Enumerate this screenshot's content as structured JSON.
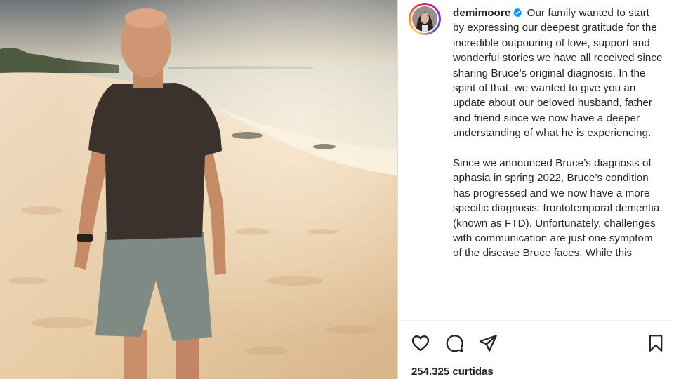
{
  "post": {
    "username": "demimoore",
    "verified_icon": "verified-badge-icon",
    "caption_paragraphs": [
      "Our family wanted to start by expressing our deepest gratitude for the incredible outpouring of love, support and wonderful stories we have all received since sharing Bruce’s original diagnosis. In the spirit of that, we wanted to give you an update about our beloved husband, father and friend since we now have a deeper understanding of what he is experiencing.",
      "Since we announced Bruce’s diagnosis of aphasia in spring 2022, Bruce’s condition has progressed and we now have a more specific diagnosis: frontotemporal dementia (known as FTD). Unfortunately, challenges with communication are just one symptom of the disease Bruce faces. While this"
    ],
    "likes_text": "254.325 curtidas"
  },
  "actions": {
    "like_icon": "heart-icon",
    "comment_icon": "comment-icon",
    "share_icon": "paper-plane-icon",
    "save_icon": "bookmark-icon"
  },
  "colors": {
    "text": "#262626",
    "verified": "#0095f6",
    "divider": "#dbdbdb"
  }
}
